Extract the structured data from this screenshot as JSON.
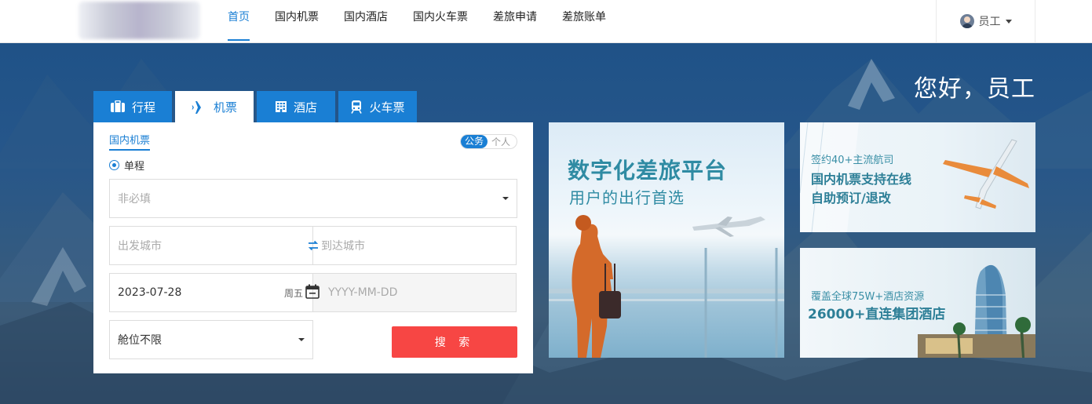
{
  "nav": {
    "items": [
      {
        "label": "首页",
        "active": true
      },
      {
        "label": "国内机票",
        "active": false
      },
      {
        "label": "国内酒店",
        "active": false
      },
      {
        "label": "国内火车票",
        "active": false
      },
      {
        "label": "差旅申请",
        "active": false
      },
      {
        "label": "差旅账单",
        "active": false
      }
    ],
    "user": {
      "name": "员工",
      "avatar_icon": "user-avatar-icon"
    }
  },
  "greeting": "您好，员工",
  "tabs": [
    {
      "label": "行程",
      "icon": "suitcase-icon",
      "active": false
    },
    {
      "label": "机票",
      "icon": "airplane-icon",
      "active": true
    },
    {
      "label": "酒店",
      "icon": "hotel-building-icon",
      "active": false
    },
    {
      "label": "火车票",
      "icon": "train-icon",
      "active": false
    }
  ],
  "search": {
    "subtab": "国内机票",
    "toggle": {
      "business": "公务",
      "personal": "个人",
      "selected": "公务"
    },
    "trip_type": {
      "label": "单程",
      "selected": true
    },
    "optional_select": {
      "placeholder": "非必填",
      "value": ""
    },
    "from_city": {
      "placeholder": "出发城市",
      "value": ""
    },
    "to_city": {
      "placeholder": "到达城市",
      "value": ""
    },
    "depart_date": {
      "value": "2023-07-28",
      "weekday": "周五"
    },
    "return_date": {
      "placeholder": "YYYY-MM-DD",
      "value": ""
    },
    "cabin": {
      "value": "舱位不限"
    },
    "search_button": "搜 索"
  },
  "promos": {
    "big": {
      "title": "数字化差旅平台",
      "subtitle": "用户的出行首选"
    },
    "flight": {
      "line1": "签约40+主流航司",
      "line2": "国内机票支持在线",
      "line3": "自助预订/退改"
    },
    "hotel": {
      "line1": "覆盖全球75W+酒店资源",
      "line2": "26000+直连集团酒店"
    }
  },
  "colors": {
    "accent": "#1a7fd4",
    "search_button": "#f74644",
    "promo_text": "#2f8ba3"
  }
}
